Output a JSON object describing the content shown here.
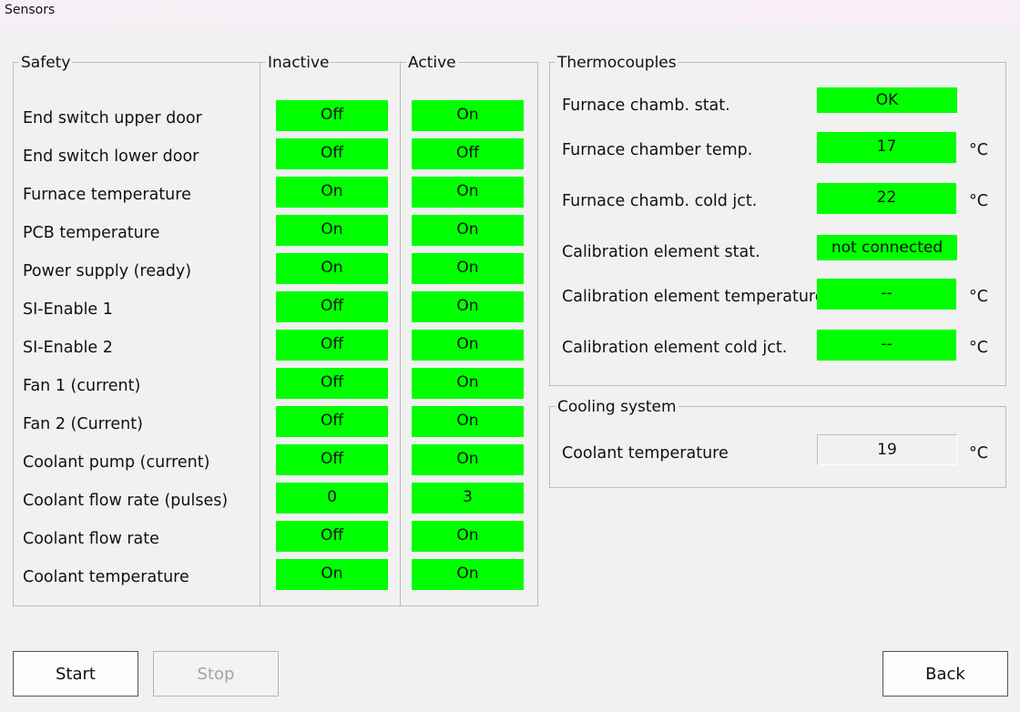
{
  "window": {
    "title": "Sensors"
  },
  "safety": {
    "group_title": "Safety",
    "inactive_title": "Inactive",
    "active_title": "Active",
    "rows": [
      {
        "label": "End switch upper door",
        "inactive": "Off",
        "active": "On"
      },
      {
        "label": "End switch lower door",
        "inactive": "Off",
        "active": "Off"
      },
      {
        "label": "Furnace temperature",
        "inactive": "On",
        "active": "On"
      },
      {
        "label": "PCB temperature",
        "inactive": "On",
        "active": "On"
      },
      {
        "label": "Power supply (ready)",
        "inactive": "On",
        "active": "On"
      },
      {
        "label": "SI-Enable 1",
        "inactive": "Off",
        "active": "On"
      },
      {
        "label": "SI-Enable 2",
        "inactive": "Off",
        "active": "On"
      },
      {
        "label": "Fan 1 (current)",
        "inactive": "Off",
        "active": "On"
      },
      {
        "label": "Fan 2 (Current)",
        "inactive": "Off",
        "active": "On"
      },
      {
        "label": "Coolant pump (current)",
        "inactive": "Off",
        "active": "On"
      },
      {
        "label": "Coolant flow rate (pulses)",
        "inactive": "0",
        "active": "3"
      },
      {
        "label": "Coolant flow rate",
        "inactive": "Off",
        "active": "On"
      },
      {
        "label": "Coolant temperature",
        "inactive": "On",
        "active": "On"
      }
    ]
  },
  "thermocouples": {
    "group_title": "Thermocouples",
    "rows": [
      {
        "label": "Furnace chamb. stat.",
        "value": "OK",
        "unit": ""
      },
      {
        "label": "Furnace chamber temp.",
        "value": "17",
        "unit": "°C"
      },
      {
        "label": "Furnace chamb. cold jct.",
        "value": "22",
        "unit": "°C"
      },
      {
        "label": "Calibration element stat.",
        "value": "not connected",
        "unit": ""
      },
      {
        "label": "Calibration element temperature",
        "value": "--",
        "unit": "°C"
      },
      {
        "label": "Calibration element cold jct.",
        "value": "--",
        "unit": "°C"
      }
    ]
  },
  "cooling": {
    "group_title": "Cooling system",
    "label": "Coolant temperature",
    "value": "19",
    "unit": "°C"
  },
  "buttons": {
    "start": "Start",
    "stop": "Stop",
    "back": "Back"
  },
  "colors": {
    "ok": "#00ff00",
    "background": "#f1f1f1",
    "border": "#bdbdbd"
  }
}
